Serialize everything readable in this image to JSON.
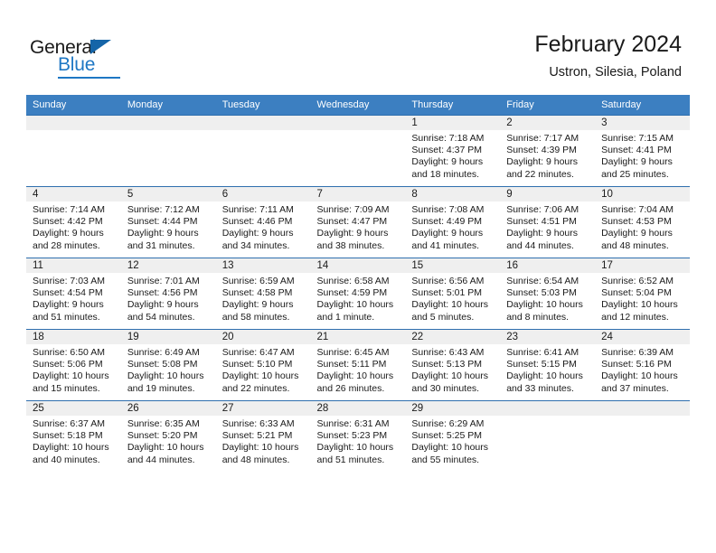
{
  "brand": {
    "name_top": "General",
    "name_bottom": "Blue",
    "accent_color": "#1e77c4",
    "triangle_color": "#1565a8"
  },
  "header": {
    "title": "February 2024",
    "subtitle": "Ustron, Silesia, Poland"
  },
  "theme": {
    "header_row_bg": "#3c7fc1",
    "header_row_text": "#ffffff",
    "row_divider": "#2f6fae",
    "day_band_bg": "#efefef",
    "body_text": "#1a1a1a"
  },
  "calendar": {
    "weekday_headers": [
      "Sunday",
      "Monday",
      "Tuesday",
      "Wednesday",
      "Thursday",
      "Friday",
      "Saturday"
    ],
    "labels": {
      "sunrise": "Sunrise:",
      "sunset": "Sunset:",
      "daylight": "Daylight:"
    },
    "weeks": [
      [
        {
          "day": ""
        },
        {
          "day": ""
        },
        {
          "day": ""
        },
        {
          "day": ""
        },
        {
          "day": "1",
          "sunrise": "Sunrise: 7:18 AM",
          "sunset": "Sunset: 4:37 PM",
          "daylight_line1": "Daylight: 9 hours",
          "daylight_line2": "and 18 minutes."
        },
        {
          "day": "2",
          "sunrise": "Sunrise: 7:17 AM",
          "sunset": "Sunset: 4:39 PM",
          "daylight_line1": "Daylight: 9 hours",
          "daylight_line2": "and 22 minutes."
        },
        {
          "day": "3",
          "sunrise": "Sunrise: 7:15 AM",
          "sunset": "Sunset: 4:41 PM",
          "daylight_line1": "Daylight: 9 hours",
          "daylight_line2": "and 25 minutes."
        }
      ],
      [
        {
          "day": "4",
          "sunrise": "Sunrise: 7:14 AM",
          "sunset": "Sunset: 4:42 PM",
          "daylight_line1": "Daylight: 9 hours",
          "daylight_line2": "and 28 minutes."
        },
        {
          "day": "5",
          "sunrise": "Sunrise: 7:12 AM",
          "sunset": "Sunset: 4:44 PM",
          "daylight_line1": "Daylight: 9 hours",
          "daylight_line2": "and 31 minutes."
        },
        {
          "day": "6",
          "sunrise": "Sunrise: 7:11 AM",
          "sunset": "Sunset: 4:46 PM",
          "daylight_line1": "Daylight: 9 hours",
          "daylight_line2": "and 34 minutes."
        },
        {
          "day": "7",
          "sunrise": "Sunrise: 7:09 AM",
          "sunset": "Sunset: 4:47 PM",
          "daylight_line1": "Daylight: 9 hours",
          "daylight_line2": "and 38 minutes."
        },
        {
          "day": "8",
          "sunrise": "Sunrise: 7:08 AM",
          "sunset": "Sunset: 4:49 PM",
          "daylight_line1": "Daylight: 9 hours",
          "daylight_line2": "and 41 minutes."
        },
        {
          "day": "9",
          "sunrise": "Sunrise: 7:06 AM",
          "sunset": "Sunset: 4:51 PM",
          "daylight_line1": "Daylight: 9 hours",
          "daylight_line2": "and 44 minutes."
        },
        {
          "day": "10",
          "sunrise": "Sunrise: 7:04 AM",
          "sunset": "Sunset: 4:53 PM",
          "daylight_line1": "Daylight: 9 hours",
          "daylight_line2": "and 48 minutes."
        }
      ],
      [
        {
          "day": "11",
          "sunrise": "Sunrise: 7:03 AM",
          "sunset": "Sunset: 4:54 PM",
          "daylight_line1": "Daylight: 9 hours",
          "daylight_line2": "and 51 minutes."
        },
        {
          "day": "12",
          "sunrise": "Sunrise: 7:01 AM",
          "sunset": "Sunset: 4:56 PM",
          "daylight_line1": "Daylight: 9 hours",
          "daylight_line2": "and 54 minutes."
        },
        {
          "day": "13",
          "sunrise": "Sunrise: 6:59 AM",
          "sunset": "Sunset: 4:58 PM",
          "daylight_line1": "Daylight: 9 hours",
          "daylight_line2": "and 58 minutes."
        },
        {
          "day": "14",
          "sunrise": "Sunrise: 6:58 AM",
          "sunset": "Sunset: 4:59 PM",
          "daylight_line1": "Daylight: 10 hours",
          "daylight_line2": "and 1 minute."
        },
        {
          "day": "15",
          "sunrise": "Sunrise: 6:56 AM",
          "sunset": "Sunset: 5:01 PM",
          "daylight_line1": "Daylight: 10 hours",
          "daylight_line2": "and 5 minutes."
        },
        {
          "day": "16",
          "sunrise": "Sunrise: 6:54 AM",
          "sunset": "Sunset: 5:03 PM",
          "daylight_line1": "Daylight: 10 hours",
          "daylight_line2": "and 8 minutes."
        },
        {
          "day": "17",
          "sunrise": "Sunrise: 6:52 AM",
          "sunset": "Sunset: 5:04 PM",
          "daylight_line1": "Daylight: 10 hours",
          "daylight_line2": "and 12 minutes."
        }
      ],
      [
        {
          "day": "18",
          "sunrise": "Sunrise: 6:50 AM",
          "sunset": "Sunset: 5:06 PM",
          "daylight_line1": "Daylight: 10 hours",
          "daylight_line2": "and 15 minutes."
        },
        {
          "day": "19",
          "sunrise": "Sunrise: 6:49 AM",
          "sunset": "Sunset: 5:08 PM",
          "daylight_line1": "Daylight: 10 hours",
          "daylight_line2": "and 19 minutes."
        },
        {
          "day": "20",
          "sunrise": "Sunrise: 6:47 AM",
          "sunset": "Sunset: 5:10 PM",
          "daylight_line1": "Daylight: 10 hours",
          "daylight_line2": "and 22 minutes."
        },
        {
          "day": "21",
          "sunrise": "Sunrise: 6:45 AM",
          "sunset": "Sunset: 5:11 PM",
          "daylight_line1": "Daylight: 10 hours",
          "daylight_line2": "and 26 minutes."
        },
        {
          "day": "22",
          "sunrise": "Sunrise: 6:43 AM",
          "sunset": "Sunset: 5:13 PM",
          "daylight_line1": "Daylight: 10 hours",
          "daylight_line2": "and 30 minutes."
        },
        {
          "day": "23",
          "sunrise": "Sunrise: 6:41 AM",
          "sunset": "Sunset: 5:15 PM",
          "daylight_line1": "Daylight: 10 hours",
          "daylight_line2": "and 33 minutes."
        },
        {
          "day": "24",
          "sunrise": "Sunrise: 6:39 AM",
          "sunset": "Sunset: 5:16 PM",
          "daylight_line1": "Daylight: 10 hours",
          "daylight_line2": "and 37 minutes."
        }
      ],
      [
        {
          "day": "25",
          "sunrise": "Sunrise: 6:37 AM",
          "sunset": "Sunset: 5:18 PM",
          "daylight_line1": "Daylight: 10 hours",
          "daylight_line2": "and 40 minutes."
        },
        {
          "day": "26",
          "sunrise": "Sunrise: 6:35 AM",
          "sunset": "Sunset: 5:20 PM",
          "daylight_line1": "Daylight: 10 hours",
          "daylight_line2": "and 44 minutes."
        },
        {
          "day": "27",
          "sunrise": "Sunrise: 6:33 AM",
          "sunset": "Sunset: 5:21 PM",
          "daylight_line1": "Daylight: 10 hours",
          "daylight_line2": "and 48 minutes."
        },
        {
          "day": "28",
          "sunrise": "Sunrise: 6:31 AM",
          "sunset": "Sunset: 5:23 PM",
          "daylight_line1": "Daylight: 10 hours",
          "daylight_line2": "and 51 minutes."
        },
        {
          "day": "29",
          "sunrise": "Sunrise: 6:29 AM",
          "sunset": "Sunset: 5:25 PM",
          "daylight_line1": "Daylight: 10 hours",
          "daylight_line2": "and 55 minutes."
        },
        {
          "day": ""
        },
        {
          "day": ""
        }
      ]
    ]
  }
}
